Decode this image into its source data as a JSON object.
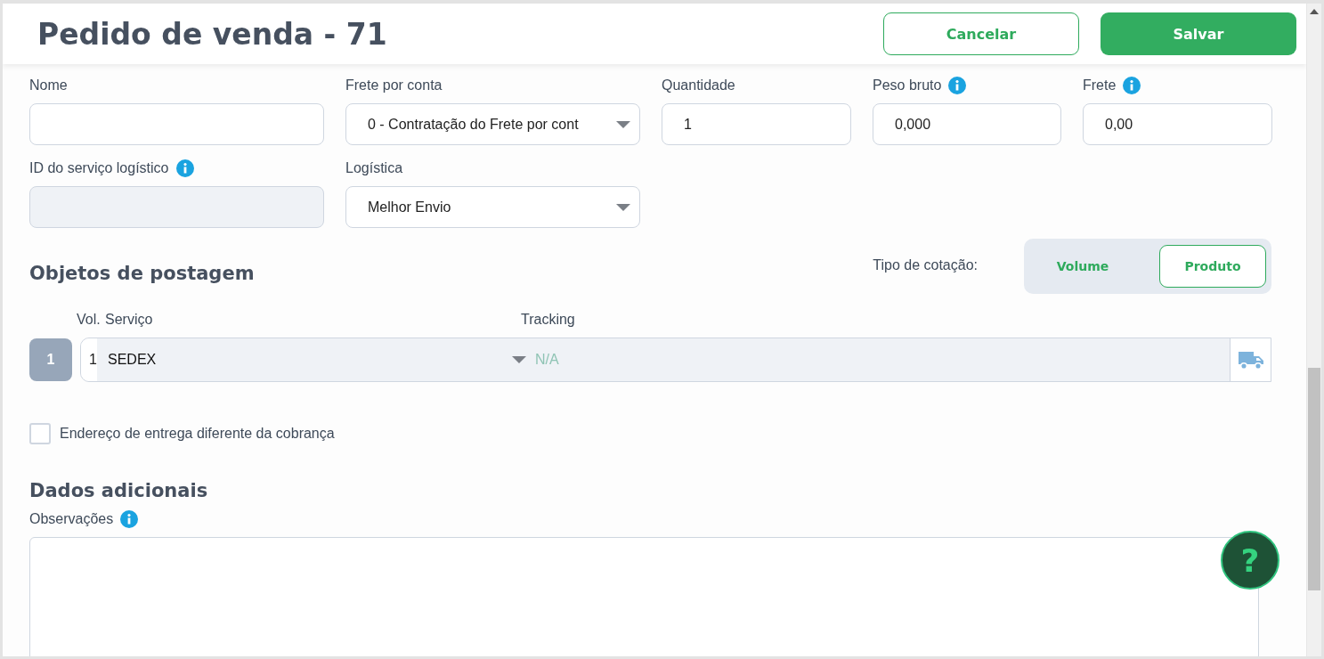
{
  "header": {
    "title": "Pedido de venda - 71",
    "buttons": [
      {
        "label": "Cancelar",
        "kind": "outline"
      },
      {
        "label": "Salvar",
        "kind": "primary"
      }
    ]
  },
  "transportador": {
    "fields": [
      {
        "label": "Nome",
        "kind": "text",
        "info": false
      },
      {
        "label": "Frete por conta",
        "kind": "select",
        "value": "0 - Contratação do Frete por cont",
        "info": false
      },
      {
        "label": "Quantidade",
        "kind": "text",
        "value": "1",
        "info": false
      },
      {
        "label": "Peso bruto",
        "kind": "text",
        "value": "0,000",
        "info": true
      },
      {
        "label": "Frete",
        "kind": "text",
        "value": "0,00",
        "info": true
      }
    ],
    "fields_row2": [
      {
        "label": "ID do serviço logístico",
        "kind": "text",
        "info": true,
        "disabled": true
      },
      {
        "label": "Logística",
        "kind": "select",
        "value": "Melhor Envio",
        "info": false,
        "disabled": false
      }
    ]
  },
  "objetos": {
    "title": "Objetos de postagem",
    "quote_type_label": "Tipo de cotação:",
    "quote_types": [
      {
        "label": "Volume",
        "selected": false
      },
      {
        "label": "Produto",
        "selected": true
      }
    ],
    "columns": [
      "Vol.",
      "Serviço",
      "Tracking"
    ],
    "rows": [
      {
        "index": "1",
        "volume": "1",
        "service": "SEDEX",
        "tracking": "N/A"
      }
    ]
  },
  "delivery_checkbox": {
    "label": "Endereço de entrega diferente da cobrança",
    "checked": false
  },
  "dados_adicionais": {
    "title": "Dados adicionais",
    "observacoes_label": "Observações",
    "observacoes_info": true
  },
  "help_button": {
    "label": "?"
  }
}
